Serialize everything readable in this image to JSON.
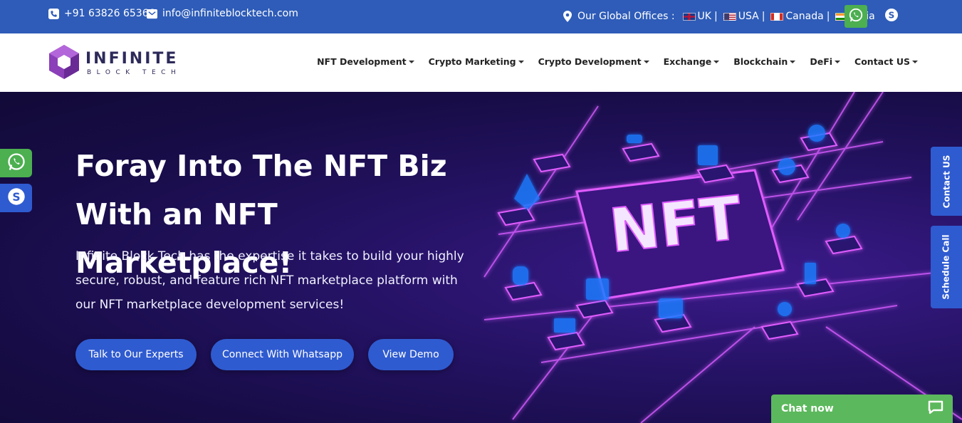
{
  "topbar": {
    "phone": "+91 63826 65366",
    "email": "info@infiniteblocktech.com",
    "offices_label": "Our Global Offices :",
    "offices": [
      "UK",
      "USA",
      "Canada",
      "India"
    ]
  },
  "logo": {
    "name": "INFINITE",
    "sub": "BLOCK TECH"
  },
  "nav": {
    "items": [
      "NFT Development",
      "Crypto Marketing",
      "Crypto Development",
      "Exchange",
      "Blockchain",
      "DeFi",
      "Contact US"
    ]
  },
  "hero": {
    "title_line1": "Foray Into The NFT Biz",
    "title_line2": "With an NFT Marketplace!",
    "description": "Infinite Block Tech has the expertise it takes to build your highly secure, robust, and feature rich NFT marketplace platform with our NFT marketplace development services!",
    "art_text": "NFT",
    "buttons": [
      "Talk to Our Experts",
      "Connect With Whatsapp",
      "View Demo"
    ]
  },
  "side_tabs": {
    "contact": "Contact US",
    "schedule": "Schedule Call"
  },
  "chat": {
    "label": "Chat now"
  },
  "colors": {
    "topbar": "#2e5cb8",
    "button": "#2f5bd0",
    "whatsapp": "#4caf50",
    "chat": "#5cb85c",
    "hero_bg": "#1a0f4a",
    "neon": "#e05cff"
  }
}
